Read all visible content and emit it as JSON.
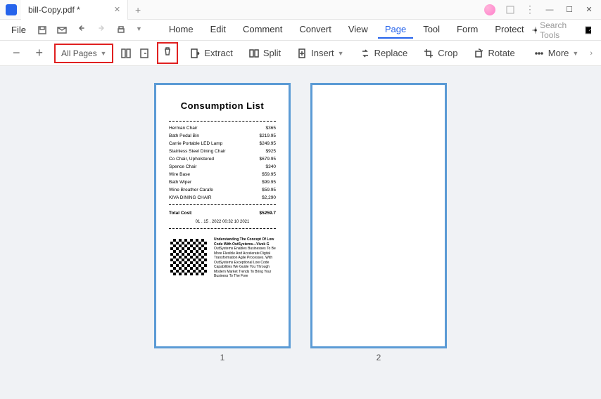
{
  "titlebar": {
    "tab_label": "bill-Copy.pdf *"
  },
  "menubar": {
    "file": "File",
    "items": [
      "Home",
      "Edit",
      "Comment",
      "Convert",
      "View",
      "Page",
      "Tool",
      "Form",
      "Protect"
    ],
    "active_index": 5,
    "search_placeholder": "Search Tools"
  },
  "toolbar": {
    "dropdown": "All Pages",
    "extract": "Extract",
    "split": "Split",
    "insert": "Insert",
    "replace": "Replace",
    "crop": "Crop",
    "rotate": "Rotate",
    "more": "More"
  },
  "pages": {
    "p1": "1",
    "p2": "2"
  },
  "document": {
    "title": "Consumption List",
    "items": [
      {
        "name": "Herman Chair",
        "price": "$365"
      },
      {
        "name": "Bath Pedal Bin",
        "price": "$219.95"
      },
      {
        "name": "Carrie Portable LED Lamp",
        "price": "$249.95"
      },
      {
        "name": "Stainless Steel Dining Chair",
        "price": "$925"
      },
      {
        "name": "Co Chair, Upholstered",
        "price": "$679.95"
      },
      {
        "name": "Spence Chair",
        "price": "$340"
      },
      {
        "name": "Wire Base",
        "price": "$59.95"
      },
      {
        "name": "Bath Wiper",
        "price": "$99.95"
      },
      {
        "name": "Wine Breather Carafe",
        "price": "$59.95"
      },
      {
        "name": "KIVA DINING CHAIR",
        "price": "$2,290"
      }
    ],
    "total_label": "Total Cost:",
    "total_value": "$5259.7",
    "timestamp": "01 . 15 . 2022   00:32  10 2021",
    "footer_title": "Understanding The Concept Of Low Code With OutSystems—Vivek G",
    "footer_body": "OutSystems Enables Businesses To Be More Flexible And Accelerate Digital Transformation Agile Processes. With OutSystems Exceptional Low Code Capabilities We Guide You Through Modern Market Trends To Bring Your Business To The Fore"
  }
}
